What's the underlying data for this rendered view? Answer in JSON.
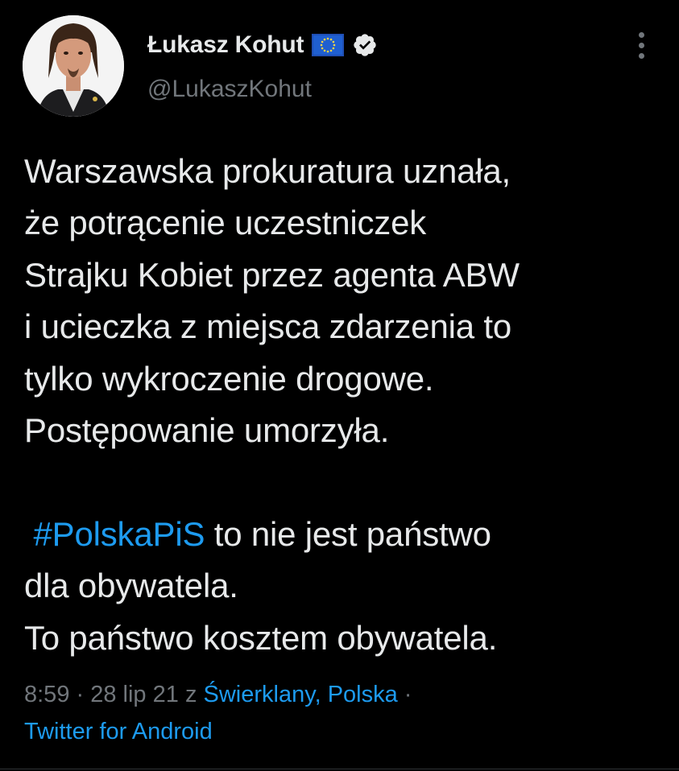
{
  "author": {
    "display_name": "Łukasz Kohut",
    "handle": "@LukaszKohut",
    "verified": true,
    "badge_icon": "eu-flag-icon"
  },
  "tweet": {
    "lines_paragraph1": [
      "Warszawska prokuratura uznała,",
      "że potrącenie uczestniczek",
      "Strajku Kobiet przez agenta ABW",
      "i ucieczka z miejsca zdarzenia to",
      "tylko wykroczenie drogowe.",
      "Postępowanie umorzyła."
    ],
    "hashtag": "#PolskaPiS",
    "hashtag_rest": " to nie jest państwo",
    "lines_paragraph2": [
      "dla obywatela.",
      "To państwo kosztem obywatela."
    ]
  },
  "meta": {
    "time": "8:59",
    "separator": " · ",
    "date": "28 lip 21",
    "location_prefix": " z ",
    "location": "Świerklany, Polska",
    "trailing_separator": " ·",
    "source": "Twitter for Android"
  },
  "colors": {
    "background": "#000000",
    "text": "#e7e9ea",
    "secondary": "#71767b",
    "link": "#1d9bf0"
  }
}
